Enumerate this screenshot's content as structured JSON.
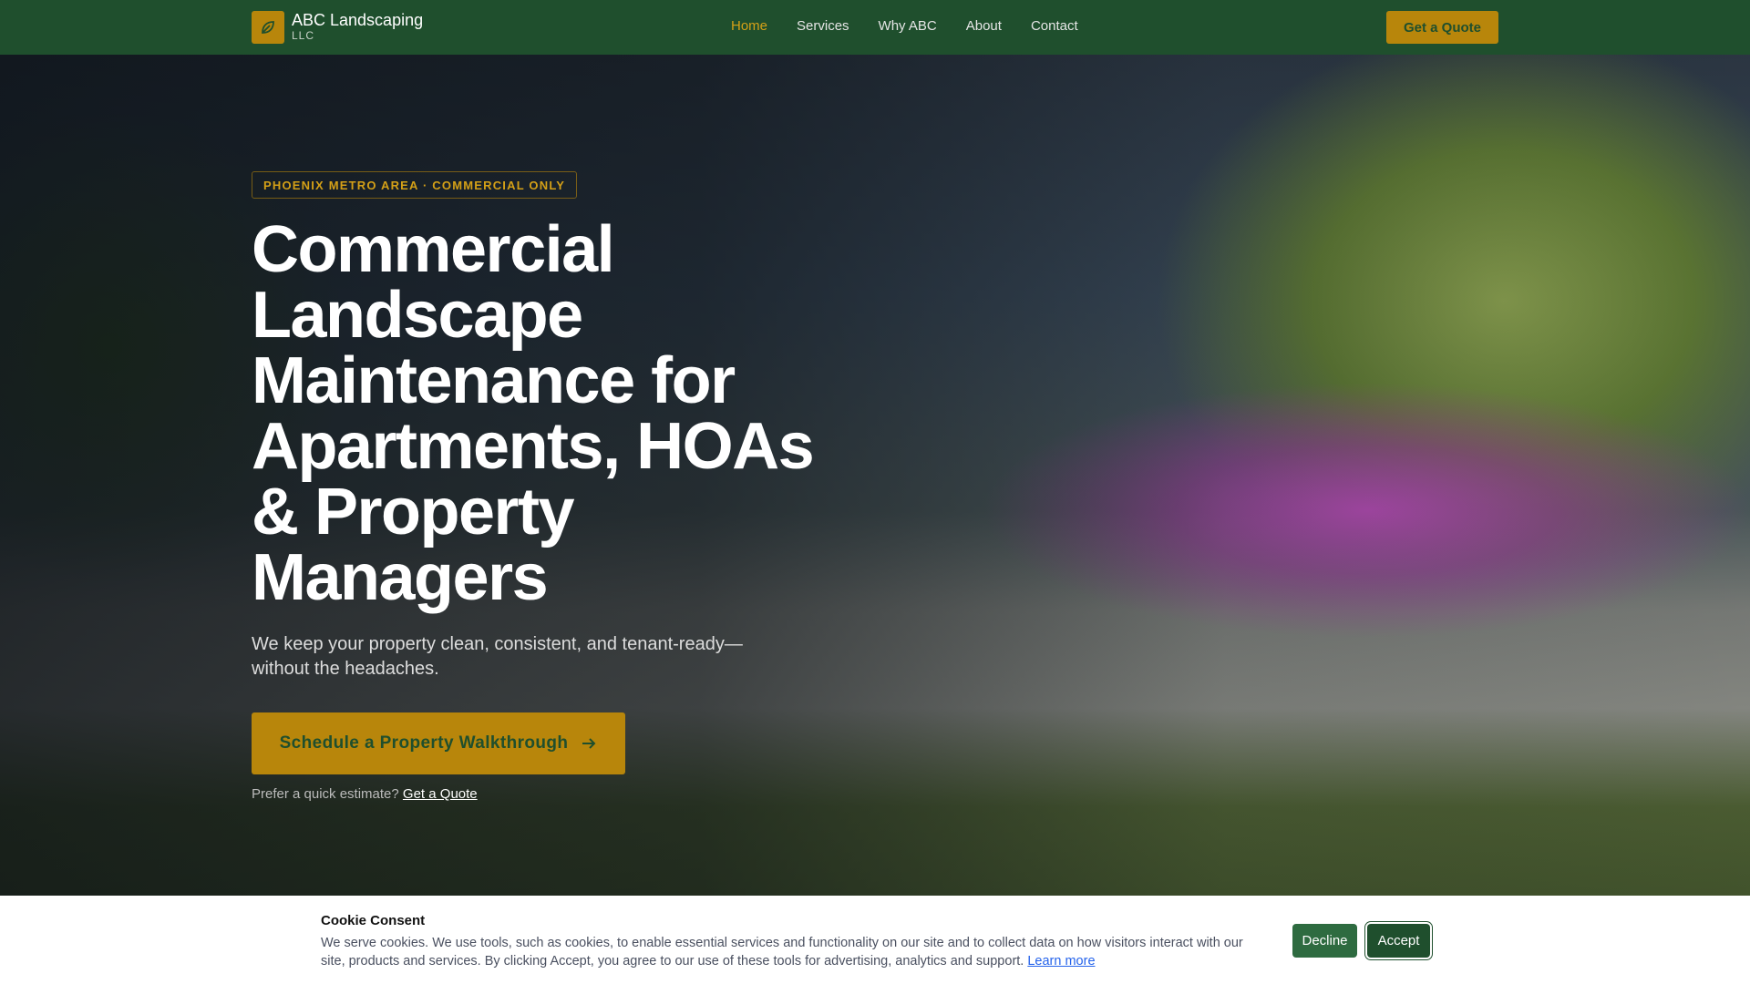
{
  "nav": {
    "brand": "ABC Landscaping",
    "brand_sub": "LLC",
    "links": [
      "Home",
      "Services",
      "Why ABC",
      "About",
      "Contact"
    ],
    "active": "Home",
    "cta": "Get a Quote"
  },
  "hero": {
    "badge": "PHOENIX METRO AREA · COMMERCIAL ONLY",
    "title": "Commercial Landscape Maintenance for Apartments, HOAs & Property Managers",
    "subtitle": "We keep your property clean, consistent, and tenant-ready—without the headaches.",
    "cta": "Schedule a Property Walkthrough",
    "alt_prefix": "Prefer a quick estimate?",
    "alt_link": "Get a Quote"
  },
  "cookie": {
    "title": "Cookie Consent",
    "text": "We serve cookies. We use tools, such as cookies, to enable essential services and functionality on our site and to collect data on how visitors interact with our site, products and services. By clicking Accept, you agree to our use of these tools for advertising, analytics and support.",
    "learn_more": "Learn more",
    "decline": "Decline",
    "accept": "Accept"
  },
  "colors": {
    "brand_green": "#1f4f2d",
    "accent_gold": "#b8860b"
  }
}
